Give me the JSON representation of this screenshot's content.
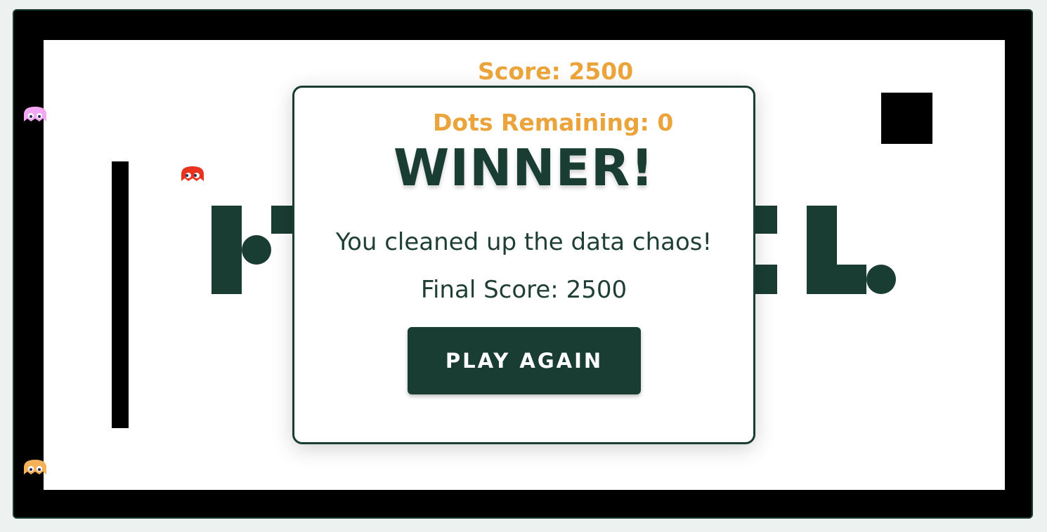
{
  "hud": {
    "score_text": "Score: 2500",
    "dots_text": "Dots Remaining: 0"
  },
  "modal": {
    "title": "WINNER!",
    "message": "You cleaned up the data chaos!",
    "final_score_text": "Final Score: 2500",
    "button_label": "PLAY AGAIN"
  },
  "ghosts": [
    {
      "name": "pink-ghost",
      "color": "#f2a6f4"
    },
    {
      "name": "red-ghost",
      "color": "#e8331f"
    },
    {
      "name": "orange-ghost",
      "color": "#f4b15a"
    }
  ],
  "colors": {
    "accent": "#eaa43b",
    "brand_dark_green": "#1a3d33",
    "wall": "#000000",
    "field": "#ffffff"
  }
}
